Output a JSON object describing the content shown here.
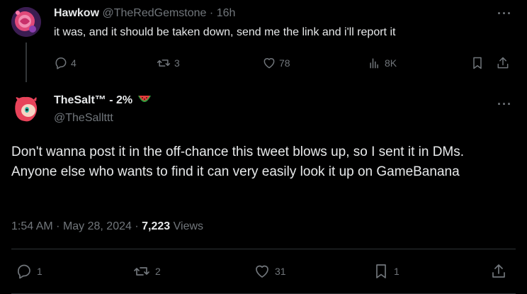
{
  "reply": {
    "display_name": "Hawkow",
    "handle": "@TheRedGemstone",
    "separator": "·",
    "time": "16h",
    "text": "it was, and it should be taken down, send me the link and i'll report it",
    "more_label": "···",
    "actions": {
      "replies": "4",
      "reposts": "3",
      "likes": "78",
      "views": "8K"
    }
  },
  "main": {
    "display_name": "TheSalt™ - 2%",
    "name_emoji": "watermelon-icon",
    "handle": "@TheSallttt",
    "more_label": "···",
    "text": "Don't wanna post it in the off-chance this tweet blows up, so I sent it in DMs. Anyone else who wants to find it can very easily look it up on GameBanana",
    "time": "1:54 AM",
    "sep1": "·",
    "date": "May 28, 2024",
    "sep2": "·",
    "views_count": "7,223",
    "views_label": "Views",
    "actions": {
      "replies": "1",
      "reposts": "2",
      "likes": "31",
      "bookmarks": "1"
    }
  },
  "colors": {
    "background": "#000000",
    "text": "#e7e9ea",
    "muted": "#71767b",
    "divider": "#2f3336"
  }
}
